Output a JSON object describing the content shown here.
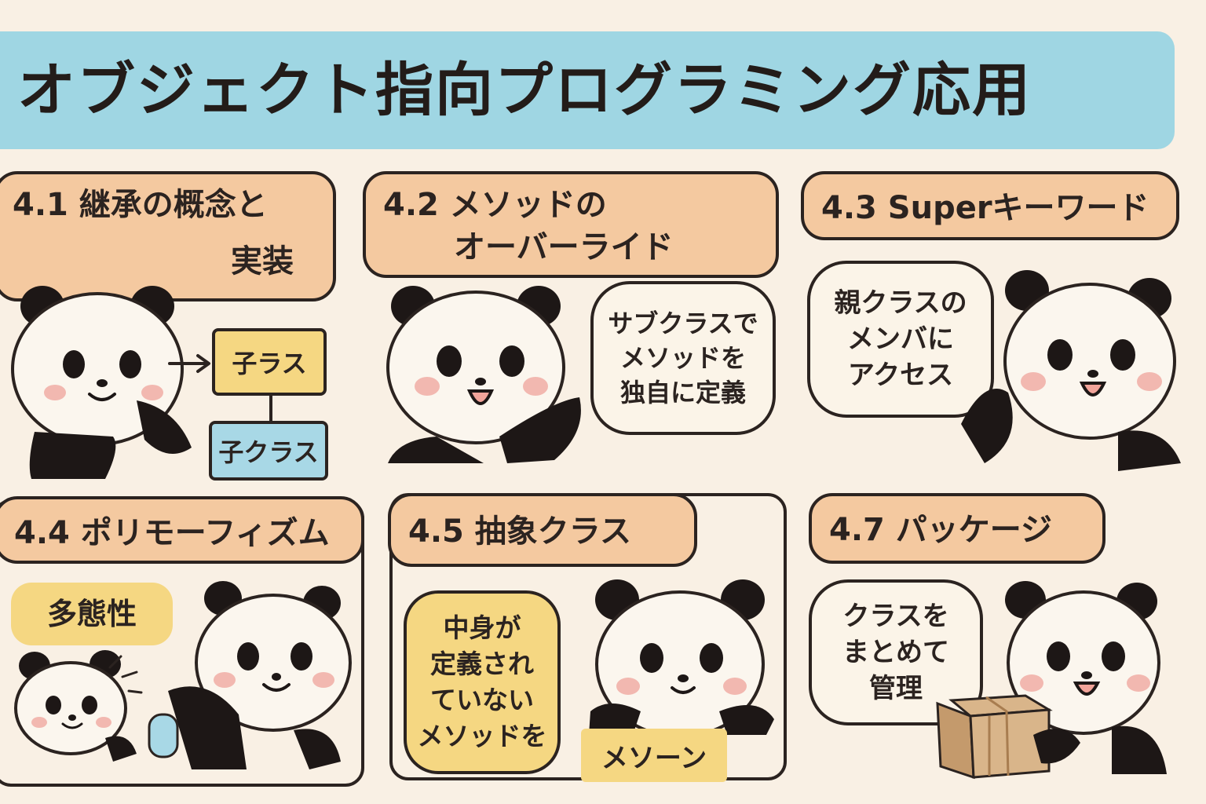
{
  "title": "オブジェクト指向プログラミング応用",
  "colors": {
    "background": "#f9f0e4",
    "banner": "#9fd6e3",
    "tab": "#f4c9a0",
    "note_yellow": "#f5d782",
    "box_blue": "#a8d8e6",
    "ink": "#2b2320",
    "cheek": "#f2b8b0"
  },
  "sections": [
    {
      "heading": [
        "4.1 継承の概念と",
        "実装"
      ],
      "boxes": [
        "子ラス",
        "子クラス"
      ],
      "panda": "panda-pointing-icon"
    },
    {
      "heading": [
        "4.2 メソッドの",
        "オーバーライド"
      ],
      "note": [
        "サブクラスで",
        "メソッドを",
        "独自に定義"
      ],
      "panda": "panda-waving-icon"
    },
    {
      "heading": [
        "4.3 Superキーワード"
      ],
      "note": [
        "親クラスの",
        "メンバに",
        "アクセス"
      ],
      "panda": "panda-happy-icon"
    },
    {
      "heading": [
        "4.4 ポリモーフィズム"
      ],
      "note": [
        "多態性"
      ],
      "panda": "panda-parent-child-icon"
    },
    {
      "heading": [
        "4.5 抽象クラス"
      ],
      "note": [
        "中身が",
        "定義され",
        "ていない",
        "メソッドを"
      ],
      "sign": "メソーン",
      "panda": "panda-holding-sign-icon"
    },
    {
      "heading": [
        "4.7 パッケージ"
      ],
      "note": [
        "クラスを",
        "まとめて",
        "管理"
      ],
      "panda": "panda-carrying-box-icon"
    }
  ]
}
